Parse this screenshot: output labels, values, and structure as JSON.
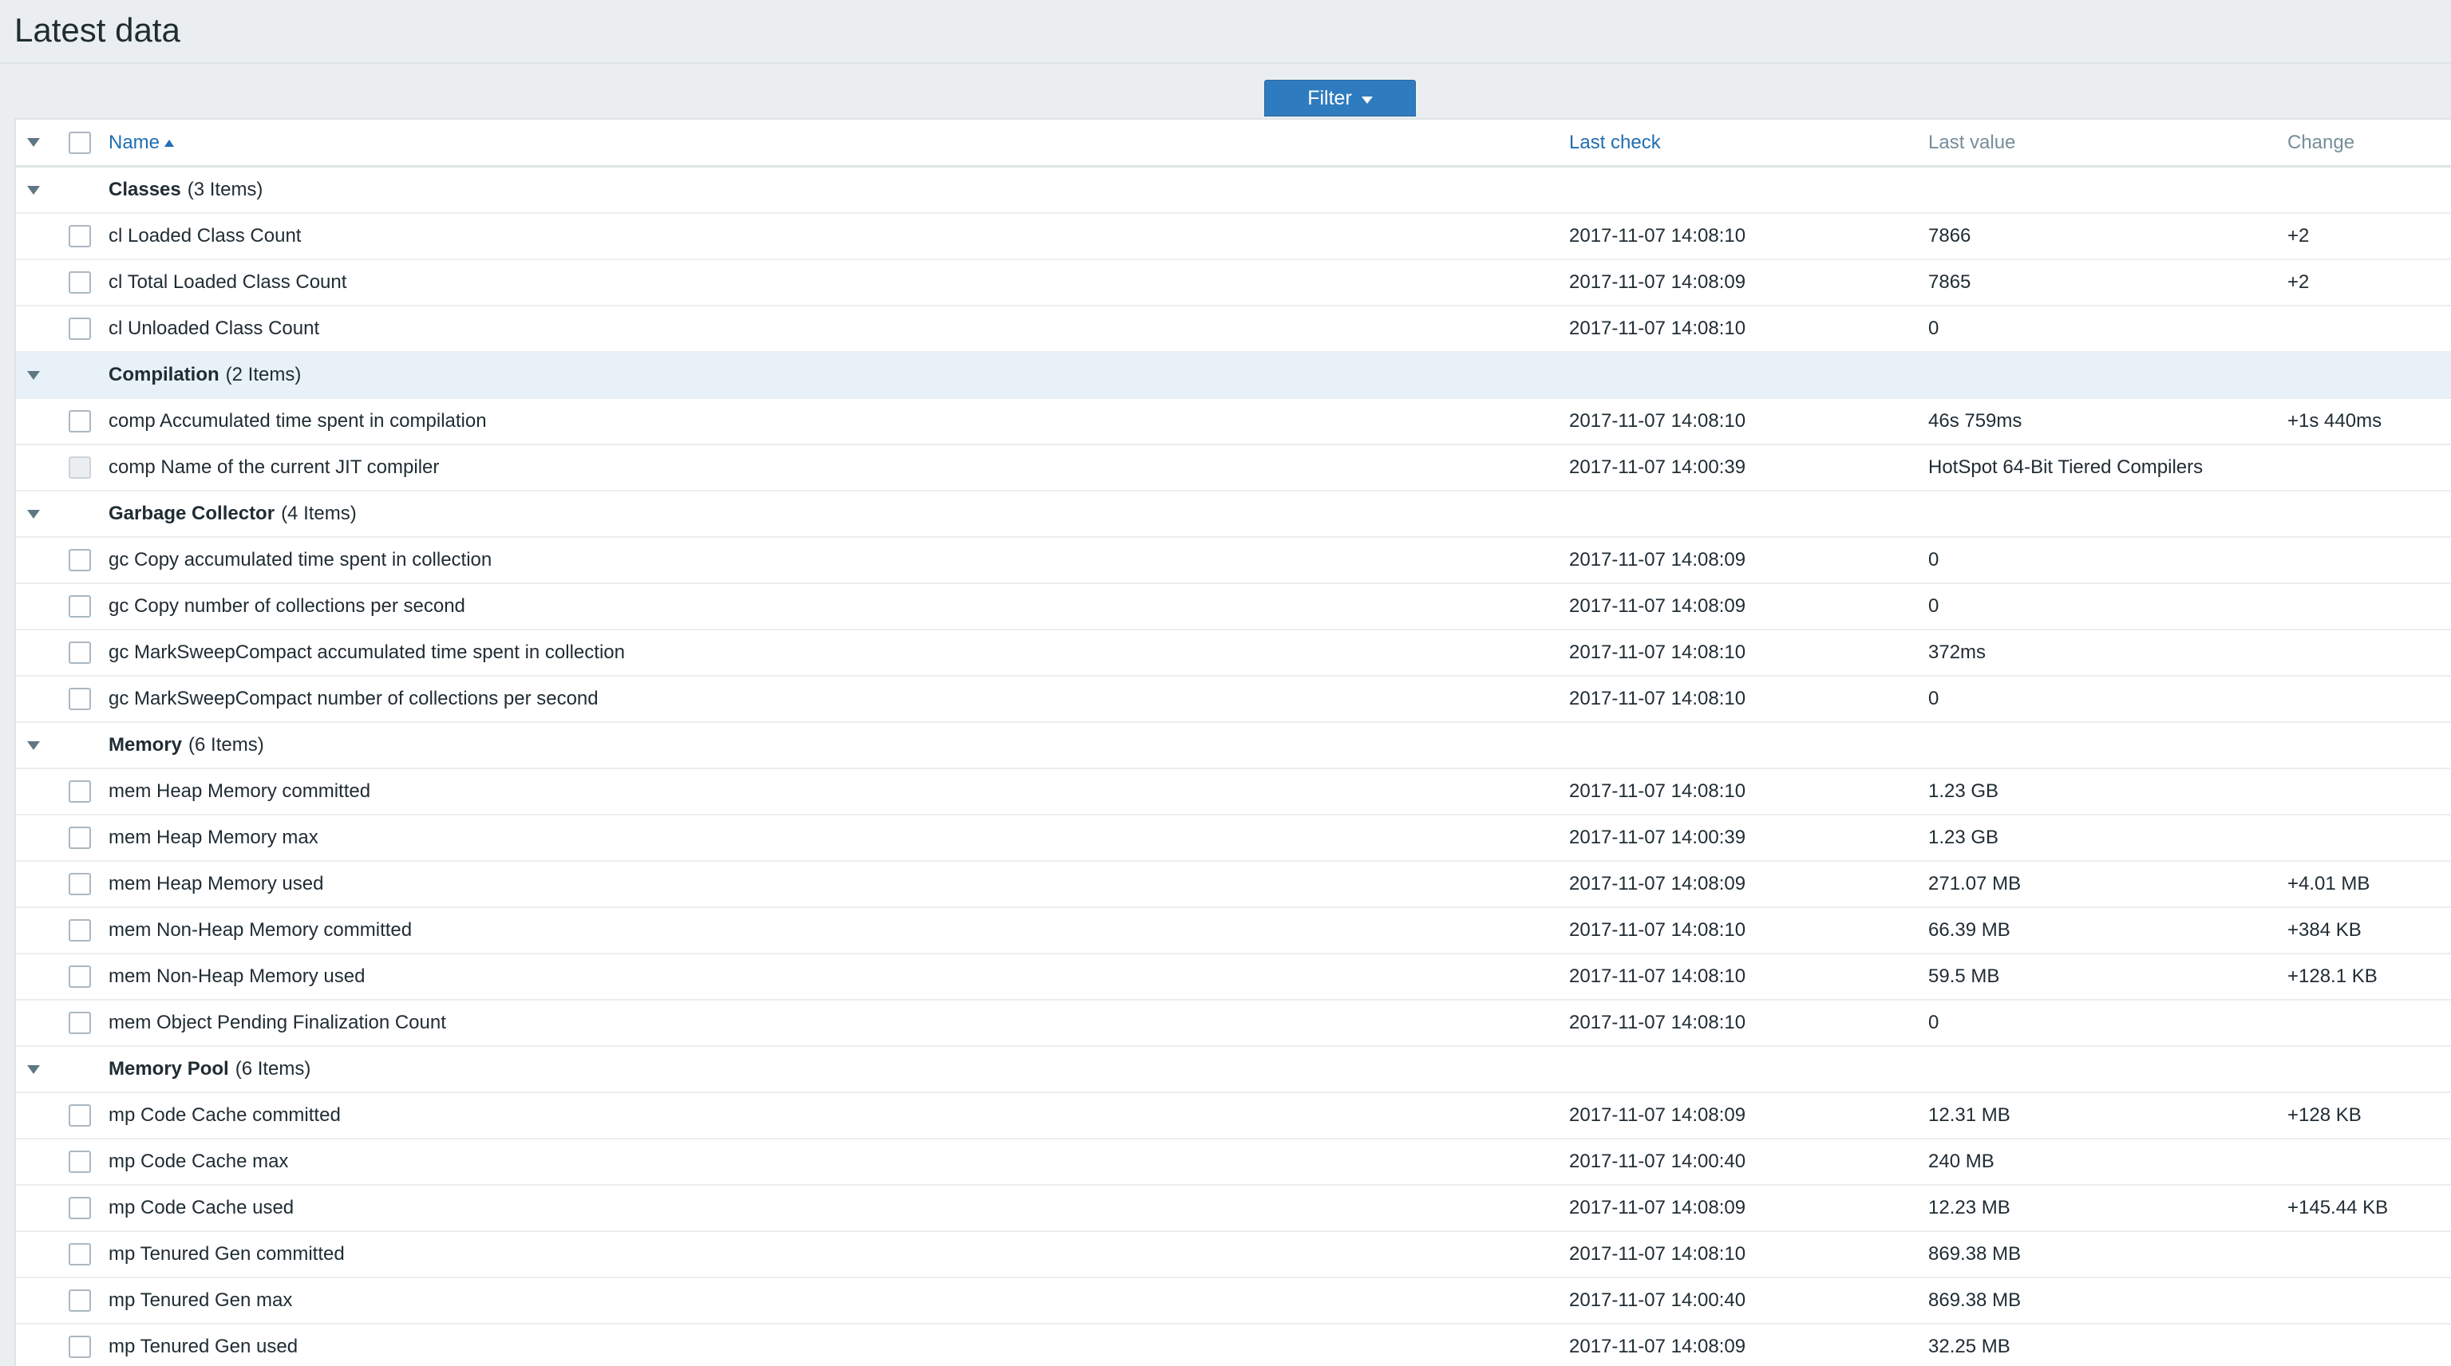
{
  "page": {
    "title": "Latest data",
    "filter_label": "Filter"
  },
  "columns": {
    "name": "Name",
    "last_check": "Last check",
    "last_value": "Last value",
    "change": "Change"
  },
  "groups": [
    {
      "name": "Classes",
      "count": "(3 Items)",
      "items": [
        {
          "name": "cl Loaded Class Count",
          "last_check": "2017-11-07 14:08:10",
          "last_value": "7866",
          "change": "+2"
        },
        {
          "name": "cl Total Loaded Class Count",
          "last_check": "2017-11-07 14:08:09",
          "last_value": "7865",
          "change": "+2"
        },
        {
          "name": "cl Unloaded Class Count",
          "last_check": "2017-11-07 14:08:10",
          "last_value": "0",
          "change": ""
        }
      ]
    },
    {
      "name": "Compilation",
      "count": "(2 Items)",
      "highlight": true,
      "items": [
        {
          "name": "comp Accumulated time spent in compilation",
          "last_check": "2017-11-07 14:08:10",
          "last_value": "46s 759ms",
          "change": "+1s 440ms"
        },
        {
          "name": "comp Name of the current JIT compiler",
          "last_check": "2017-11-07 14:00:39",
          "last_value": "HotSpot 64-Bit Tiered Compilers",
          "change": "",
          "disabled": true
        }
      ]
    },
    {
      "name": "Garbage Collector",
      "count": "(4 Items)",
      "items": [
        {
          "name": "gc Copy accumulated time spent in collection",
          "last_check": "2017-11-07 14:08:09",
          "last_value": "0",
          "change": ""
        },
        {
          "name": "gc Copy number of collections per second",
          "last_check": "2017-11-07 14:08:09",
          "last_value": "0",
          "change": ""
        },
        {
          "name": "gc MarkSweepCompact accumulated time spent in collection",
          "last_check": "2017-11-07 14:08:10",
          "last_value": "372ms",
          "change": ""
        },
        {
          "name": "gc MarkSweepCompact number of collections per second",
          "last_check": "2017-11-07 14:08:10",
          "last_value": "0",
          "change": ""
        }
      ]
    },
    {
      "name": "Memory",
      "count": "(6 Items)",
      "items": [
        {
          "name": "mem Heap Memory committed",
          "last_check": "2017-11-07 14:08:10",
          "last_value": "1.23 GB",
          "change": ""
        },
        {
          "name": "mem Heap Memory max",
          "last_check": "2017-11-07 14:00:39",
          "last_value": "1.23 GB",
          "change": ""
        },
        {
          "name": "mem Heap Memory used",
          "last_check": "2017-11-07 14:08:09",
          "last_value": "271.07 MB",
          "change": "+4.01 MB"
        },
        {
          "name": "mem Non-Heap Memory committed",
          "last_check": "2017-11-07 14:08:10",
          "last_value": "66.39 MB",
          "change": "+384 KB"
        },
        {
          "name": "mem Non-Heap Memory used",
          "last_check": "2017-11-07 14:08:10",
          "last_value": "59.5 MB",
          "change": "+128.1 KB"
        },
        {
          "name": "mem Object Pending Finalization Count",
          "last_check": "2017-11-07 14:08:10",
          "last_value": "0",
          "change": ""
        }
      ]
    },
    {
      "name": "Memory Pool",
      "count": "(6 Items)",
      "items": [
        {
          "name": "mp Code Cache committed",
          "last_check": "2017-11-07 14:08:09",
          "last_value": "12.31 MB",
          "change": "+128 KB"
        },
        {
          "name": "mp Code Cache max",
          "last_check": "2017-11-07 14:00:40",
          "last_value": "240 MB",
          "change": ""
        },
        {
          "name": "mp Code Cache used",
          "last_check": "2017-11-07 14:08:09",
          "last_value": "12.23 MB",
          "change": "+145.44 KB"
        },
        {
          "name": "mp Tenured Gen committed",
          "last_check": "2017-11-07 14:08:10",
          "last_value": "869.38 MB",
          "change": ""
        },
        {
          "name": "mp Tenured Gen max",
          "last_check": "2017-11-07 14:00:40",
          "last_value": "869.38 MB",
          "change": ""
        },
        {
          "name": "mp Tenured Gen used",
          "last_check": "2017-11-07 14:08:09",
          "last_value": "32.25 MB",
          "change": ""
        }
      ]
    }
  ]
}
